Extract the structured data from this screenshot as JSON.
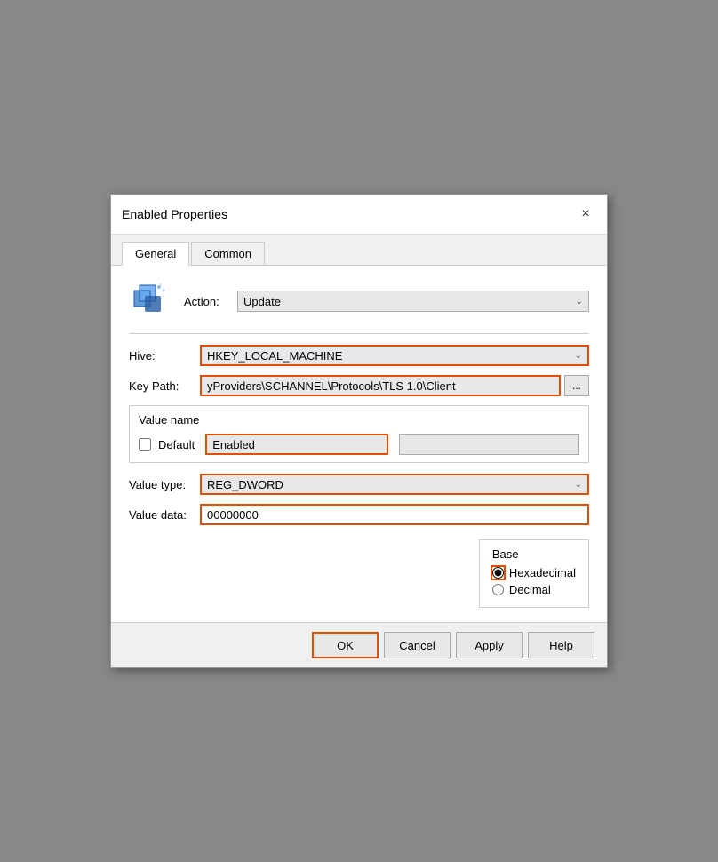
{
  "dialog": {
    "title": "Enabled Properties",
    "close_label": "×"
  },
  "tabs": [
    {
      "id": "general",
      "label": "General",
      "active": true
    },
    {
      "id": "common",
      "label": "Common",
      "active": false
    }
  ],
  "general": {
    "action_label": "Action:",
    "action_value": "Update",
    "hive_label": "Hive:",
    "hive_value": "HKEY_LOCAL_MACHINE",
    "key_path_label": "Key Path:",
    "key_path_value": "yProviders\\SCHANNEL\\Protocols\\TLS 1.0\\Client",
    "browse_label": "...",
    "value_name_group_label": "Value name",
    "default_checkbox_label": "Default",
    "value_name_input": "Enabled",
    "value_name_rest": "",
    "value_type_label": "Value type:",
    "value_type_value": "REG_DWORD",
    "value_data_label": "Value data:",
    "value_data_value": "00000000",
    "base_label": "Base",
    "hex_label": "Hexadecimal",
    "dec_label": "Decimal",
    "hex_checked": true,
    "dec_checked": false
  },
  "footer": {
    "ok_label": "OK",
    "cancel_label": "Cancel",
    "apply_label": "Apply",
    "help_label": "Help"
  }
}
